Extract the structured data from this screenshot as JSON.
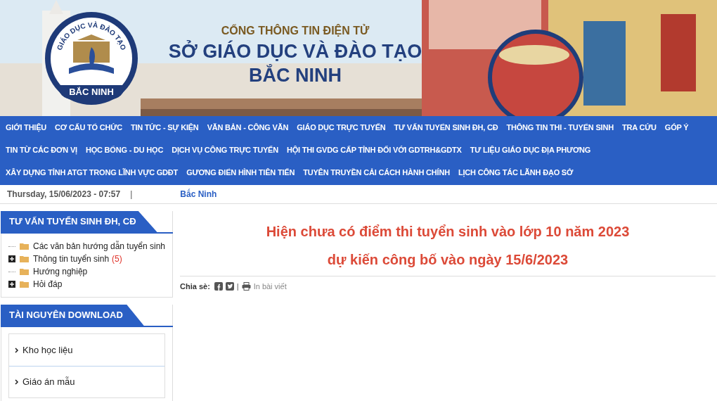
{
  "banner": {
    "logo": {
      "top_text": "GIÁO DỤC VÀ ĐÀO TẠO",
      "bottom_text": "BẮC NINH"
    },
    "kicker": "CỔNG THÔNG TIN ĐIỆN TỬ",
    "title": "SỞ GIÁO DỤC VÀ ĐÀO TẠO",
    "subtitle": "BẮC NINH"
  },
  "nav": {
    "links": [
      "GIỚI THIỆU",
      "CƠ CẤU TỔ CHỨC",
      "TIN TỨC - SỰ KIỆN",
      "VĂN BẢN - CÔNG VĂN",
      "GIÁO DỤC TRỰC TUYẾN",
      "TƯ VẤN TUYỂN SINH ĐH, CĐ",
      "THÔNG TIN THI - TUYỂN SINH",
      "TRA CỨU",
      "GÓP Ý",
      "TIN TỪ CÁC ĐƠN VỊ",
      "HỌC BỔNG - DU HỌC",
      "DỊCH VỤ CÔNG TRỰC TUYẾN",
      "HỘI THI GVDG CẤP TỈNH ĐỐI VỚI GDTRH&GDTX",
      "TƯ LIỆU GIÁO DỤC ĐỊA PHƯƠNG",
      "XÂY DỰNG TỈNH ATGT TRONG LĨNH VỰC GDĐT",
      "GƯƠNG ĐIỂN HÌNH TIÊN TIẾN",
      "TUYÊN TRUYỀN CẢI CÁCH HÀNH CHÍNH",
      "LỊCH CÔNG TÁC LÃNH ĐẠO SỞ"
    ]
  },
  "info_bar": {
    "datetime": "Thursday, 15/06/2023 - 07:57",
    "separator": "|",
    "location": "Bắc Ninh"
  },
  "sidebar": {
    "admissions": {
      "title": "TƯ VẤN TUYỂN SINH ĐH, CĐ",
      "items": [
        {
          "label": "Các văn bản hướng dẫn tuyển sinh",
          "kind": "leaf"
        },
        {
          "label": "Thông tin tuyển sinh",
          "count": "(5)",
          "kind": "branch",
          "expanded": false
        },
        {
          "label": "Hướng nghiệp",
          "kind": "leaf"
        },
        {
          "label": "Hỏi đáp",
          "kind": "branch",
          "expanded": false
        }
      ]
    },
    "downloads": {
      "title": "TÀI NGUYÊN DOWNLOAD",
      "items": [
        "Kho học liệu",
        "Giáo án mẫu"
      ]
    }
  },
  "article": {
    "headline": [
      "Hiện chưa có điểm thi tuyển sinh vào lớp 10 năm 2023",
      "dự kiến công bố vào ngày 15/6/2023"
    ],
    "share_label": "Chia sè:",
    "separator": "|",
    "print_label": "In bài viết"
  }
}
